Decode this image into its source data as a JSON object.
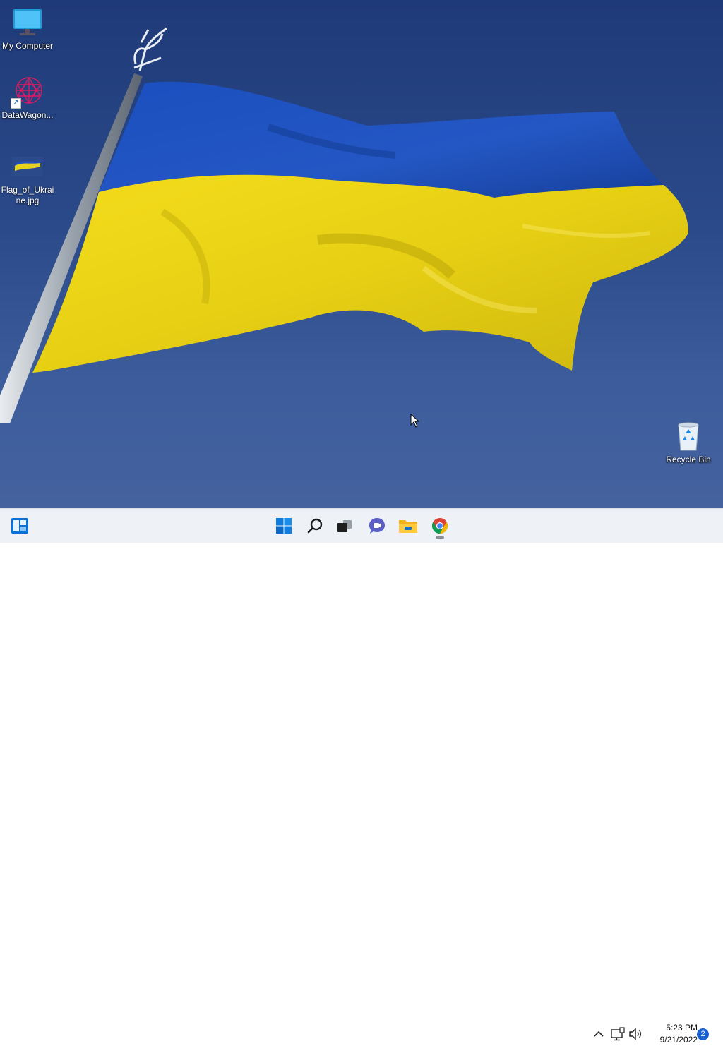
{
  "desktop": {
    "wallpaper_colors": {
      "sky": "#2b4a8a",
      "flag_blue": "#1f4fc0",
      "flag_yellow": "#eed520"
    },
    "icons": [
      {
        "label": "My Computer",
        "icon": "monitor-icon"
      },
      {
        "label": "DataWagon...",
        "icon": "datawagon-icon"
      },
      {
        "label": "Flag_of_Ukraine.jpg",
        "icon": "image-file-icon"
      },
      {
        "label": "Recycle Bin",
        "icon": "recycle-bin-icon"
      }
    ]
  },
  "taskbar": {
    "pinned": [
      {
        "name": "Widgets",
        "icon": "widgets-icon"
      },
      {
        "name": "Start",
        "icon": "windows-start-icon"
      },
      {
        "name": "Search",
        "icon": "search-icon"
      },
      {
        "name": "Task View",
        "icon": "task-view-icon"
      },
      {
        "name": "Chat",
        "icon": "chat-icon"
      },
      {
        "name": "File Explorer",
        "icon": "file-explorer-icon"
      },
      {
        "name": "Google Chrome",
        "icon": "chrome-icon"
      }
    ],
    "tray": {
      "time": "5:23 PM",
      "date": "9/21/2022",
      "notification_count": "2"
    },
    "accent": "#0078d4"
  }
}
